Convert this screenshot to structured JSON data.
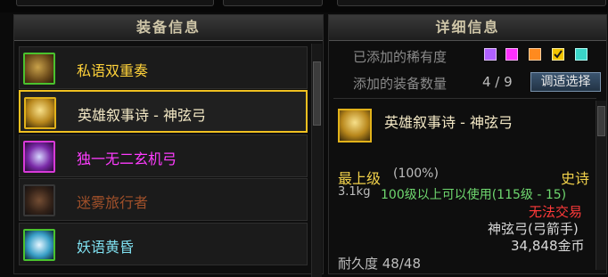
{
  "left_panel": {
    "title": "装备信息",
    "items": [
      {
        "name": "私语双重奏",
        "color": "#ffd23a",
        "icon": "serpent-creature-icon",
        "selected": false
      },
      {
        "name": "英雄叙事诗 - 神弦弓",
        "color": "#f2e7c4",
        "icon": "golden-bow-icon",
        "selected": true
      },
      {
        "name": "独一无二玄机弓",
        "color": "#ff3cff",
        "icon": "magenta-bow-icon",
        "selected": false
      },
      {
        "name": "迷雾旅行者",
        "color": "#a0502a",
        "icon": "misty-bow-icon",
        "selected": false
      },
      {
        "name": "妖语黄昏",
        "color": "#7fe0f0",
        "icon": "teal-bow-icon",
        "selected": false
      }
    ]
  },
  "right_panel": {
    "title": "详细信息",
    "rarity_label": "已添加的稀有度",
    "rarity_swatches": [
      {
        "color": "#b060ff",
        "checked": false
      },
      {
        "color": "#ff30ff",
        "checked": false
      },
      {
        "color": "#ff8a1e",
        "checked": false
      },
      {
        "color": "#f2c400",
        "checked": true
      },
      {
        "color": "#3ad6c8",
        "checked": false
      }
    ],
    "count_label": "添加的装备数量",
    "count_value": "4 / 9",
    "adjust_button": "调适选择",
    "item_name": "英雄叙事诗 - 神弦弓",
    "grade": "最上级",
    "grade_pct": "(100%)",
    "rarity": "史诗",
    "weight": "3.1kg",
    "level_req": "100级以上可以使用(115级 - 15)",
    "trade": "无法交易",
    "type": "神弦弓(弓箭手)",
    "price": "34,848金币",
    "durability": "耐久度 48/48"
  }
}
